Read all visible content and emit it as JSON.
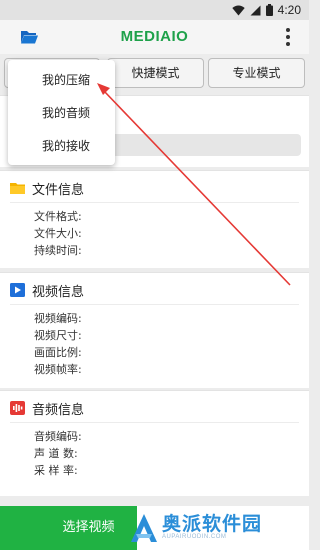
{
  "status_bar": {
    "time": "4:20",
    "icons": [
      "wifi-icon",
      "signal-icon",
      "battery-icon"
    ]
  },
  "app_bar": {
    "title": "MEDIAIO",
    "left_icon": "folder-icon",
    "right_icon": "more-vert-icon"
  },
  "tabs": [
    {
      "label": ""
    },
    {
      "label": "快捷模式"
    },
    {
      "label": "专业模式"
    }
  ],
  "popup_menu": {
    "items": [
      {
        "label": "我的压缩"
      },
      {
        "label": "我的音频"
      },
      {
        "label": "我的接收"
      }
    ]
  },
  "sections": {
    "file_info": {
      "title": "文件信息",
      "fields": [
        {
          "label": "文件格式:"
        },
        {
          "label": "文件大小:"
        },
        {
          "label": "持续时间:"
        }
      ]
    },
    "video_info": {
      "title": "视频信息",
      "fields": [
        {
          "label": "视频编码:"
        },
        {
          "label": "视频尺寸:"
        },
        {
          "label": "画面比例:"
        },
        {
          "label": "视频帧率:"
        }
      ]
    },
    "audio_info": {
      "title": "音频信息",
      "fields": [
        {
          "label": "音频编码:"
        },
        {
          "label": "声 道 数:"
        },
        {
          "label": "采 样 率:"
        }
      ]
    }
  },
  "bottom": {
    "select_button": "选择视频",
    "watermark": "奥派软件园",
    "watermark_sub": "AUPAIRUODIN.COM"
  },
  "colors": {
    "accent_green": "#1ea14a",
    "button_green": "#20b243",
    "annotation_red": "#e53935",
    "watermark_blue": "#2b8ed8"
  }
}
